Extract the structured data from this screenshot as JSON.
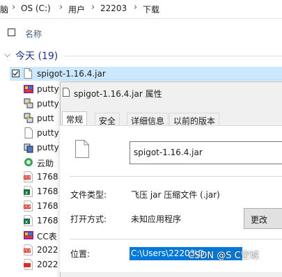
{
  "breadcrumb": {
    "items": [
      "OS (C:)",
      "用户",
      "22203",
      "下载"
    ],
    "leading_fragment": "脑"
  },
  "columns": {
    "name_label": "名称"
  },
  "group": {
    "label": "今天 (19)",
    "count": 19
  },
  "files": [
    {
      "name": "spigot-1.16.4.jar",
      "icon": "jar-file-icon",
      "selected": true
    },
    {
      "name": "putty",
      "icon": "installer-icon"
    },
    {
      "name": "putty",
      "icon": "putty-icon"
    },
    {
      "name": "putt",
      "icon": "putty-icon"
    },
    {
      "name": "putty",
      "icon": "blank-file-icon"
    },
    {
      "name": "putty",
      "icon": "putty-icon"
    },
    {
      "name": "云助",
      "icon": "app-icon"
    },
    {
      "name": "1768",
      "icon": "pdf-icon"
    },
    {
      "name": "1768",
      "icon": "excel-icon"
    },
    {
      "name": "1768",
      "icon": "pdf-icon"
    },
    {
      "name": "1768",
      "icon": "excel-icon"
    },
    {
      "name": "CC表",
      "icon": "installer-icon"
    },
    {
      "name": "2022",
      "icon": "pdf-icon"
    },
    {
      "name": "2022",
      "icon": "pdf-icon"
    }
  ],
  "dialog": {
    "title": "spigot-1.16.4.jar 属性",
    "tabs": [
      "常规",
      "安全",
      "详细信息",
      "以前的版本"
    ],
    "active_tab": "常规",
    "filename": "spigot-1.16.4.jar",
    "type_label": "文件类型:",
    "type_value": "飞压 jar 压缩文件 (.jar)",
    "open_label": "打开方式:",
    "open_value": "未知应用程序",
    "change_button": "更改",
    "location_label": "位置:",
    "location_value": "C:\\Users\\22203\\D",
    "watermark": "CSDN @S C空城"
  },
  "colors": {
    "selection": "#cce8ff",
    "accent": "#0078d7",
    "group_text": "#1e3287"
  }
}
